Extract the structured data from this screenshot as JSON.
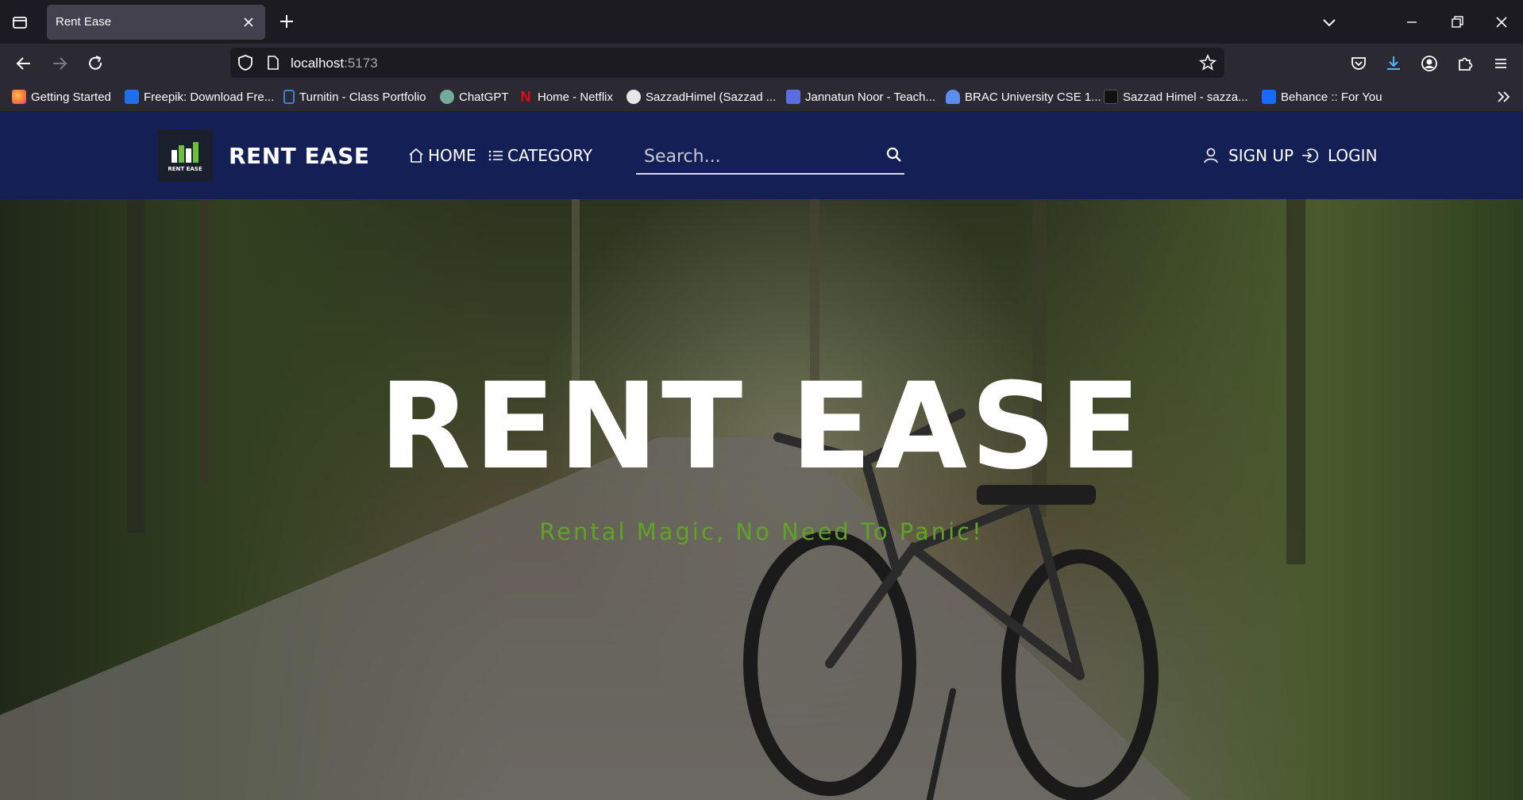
{
  "browser": {
    "tab_title": "Rent Ease",
    "url_host": "localhost",
    "url_port": ":5173",
    "bookmarks": [
      {
        "label": "Getting Started",
        "icon": "firefox-icon",
        "color": "#ff7139"
      },
      {
        "label": "Freepik: Download Fre...",
        "icon": "freepik-icon",
        "color": "#1f6feb"
      },
      {
        "label": "Turnitin - Class Portfolio",
        "icon": "turnitin-icon",
        "color": "#3d7fd8"
      },
      {
        "label": "ChatGPT",
        "icon": "chatgpt-icon",
        "color": "#74aa9c"
      },
      {
        "label": "Home - Netflix",
        "icon": "netflix-icon",
        "color": "#e50914"
      },
      {
        "label": "SazzadHimel (Sazzad ...",
        "icon": "github-icon",
        "color": "#e6e6e6"
      },
      {
        "label": "Jannatun Noor - Teach...",
        "icon": "calendar-icon",
        "color": "#5b6ee1"
      },
      {
        "label": "BRAC University CSE 1...",
        "icon": "group-icon",
        "color": "#5b8def"
      },
      {
        "label": "Sazzad Himel - sazza...",
        "icon": "medium-icon",
        "color": "#111111"
      },
      {
        "label": "Behance :: For You",
        "icon": "behance-icon",
        "color": "#1769ff"
      }
    ]
  },
  "site": {
    "brand": "RENT EASE",
    "logo_text": "RENT EASE",
    "nav": {
      "home": "HOME",
      "category": "CATEGORY"
    },
    "search_placeholder": "Search...",
    "auth": {
      "signup": "SIGN UP",
      "login": "LOGIN"
    },
    "hero": {
      "title": "RENT EASE",
      "tagline": "Rental Magic, No Need To Panic!"
    },
    "colors": {
      "header_bg": "#142055",
      "tagline": "#5fa426"
    }
  }
}
